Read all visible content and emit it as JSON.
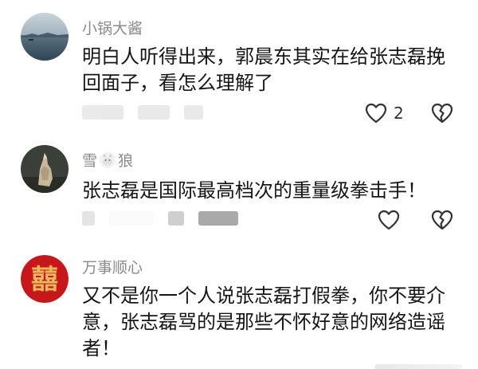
{
  "comments": [
    {
      "username": "小锅大酱",
      "text": "明白人听得出来，郭晨东其实在给张志磊挽回面子，看怎么理解了",
      "like_count": "2",
      "avatar_icon": "lake-landscape-avatar"
    },
    {
      "username_part1": "雪",
      "username_part2": "狼",
      "username_icon": "wolf-emoji-icon",
      "text": "张志磊是国际最高档次的重量级拳击手！",
      "avatar_icon": "howling-wolf-avatar"
    },
    {
      "username": "万事顺心",
      "text": "又不是你一个人说张志磊打假拳，你不要介意，张志磊骂的是那些不怀好意的网络造谣者！",
      "avatar_icon": "red-calligraphy-seal-avatar",
      "avatar_glyph": "囍"
    }
  ],
  "colors": {
    "username": "#8a8a8a",
    "body_text": "#161616",
    "icon": "#333333",
    "seal_red": "#c8171b",
    "seal_gold": "#e8b85a"
  }
}
